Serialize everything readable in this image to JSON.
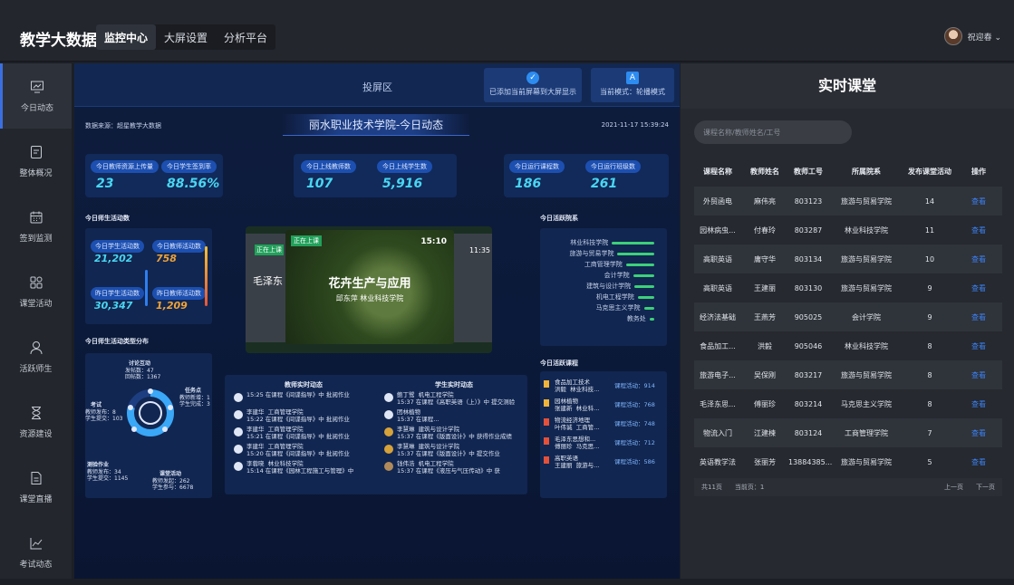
{
  "header": {
    "brand": "教学大数据",
    "tabs": [
      "监控中心",
      "大屏设置",
      "分析平台"
    ],
    "user": "祝迎春 ⌄"
  },
  "sidebar": [
    "今日动态",
    "整体概况",
    "签到监测",
    "课堂活动",
    "活跃师生",
    "资源建设",
    "课堂直播",
    "考试动态"
  ],
  "projection": {
    "title": "投屏区",
    "btn1": "已添加当前屏幕到大屏显示",
    "btn2": "当前模式：轮播模式"
  },
  "dashboard": {
    "source": "数据来源：超星教学大数据",
    "school": "丽水职业技术学院-今日动态",
    "time": "2021-11-17 15:39:24",
    "stats": [
      {
        "label": "今日教师资源上传量",
        "value": "23"
      },
      {
        "label": "今日学生签到率",
        "value": "88.56%"
      },
      {
        "label": "今日上线教师数",
        "value": "107"
      },
      {
        "label": "今日上线学生数",
        "value": "5,916"
      },
      {
        "label": "今日运行课程数",
        "value": "186"
      },
      {
        "label": "今日运行班级数",
        "value": "261"
      }
    ],
    "activity_title": "今日师生活动数",
    "activity": [
      {
        "label": "今日学生活动数",
        "value": "21,202"
      },
      {
        "label": "今日教师活动数",
        "value": "758"
      },
      {
        "label": "昨日学生活动数",
        "value": "30,347"
      },
      {
        "label": "昨日教师活动数",
        "value": "1,209"
      }
    ],
    "dist_title": "今日师生活动类型分布",
    "dist": {
      "discuss": "讨论互动",
      "discuss_v": "发帖数：47\n回帖数：1367",
      "task": "任务点",
      "task_v": "教师新增：1\n学生完成：3",
      "exam": "考试",
      "exam_v": "教师发布：8\n学生提交：103",
      "quiz": "测验作业",
      "quiz_v": "教师发布：34\n学生提交：1145",
      "class": "课堂活动",
      "class_v": "教师发起：262\n学生参与：6678"
    },
    "live": {
      "tag": "正在上课",
      "course": "花卉生产与应用",
      "teacher": "邱东萍  林业科技学院",
      "time": "15:10",
      "side_time": "11:35",
      "side_text": "毛泽东"
    },
    "dept_title": "今日活跃院系",
    "depts": [
      {
        "name": "林业科技学院",
        "v": 0.9
      },
      {
        "name": "旅游与贸易学院",
        "v": 0.78
      },
      {
        "name": "工商管理学院",
        "v": 0.6
      },
      {
        "name": "会计学院",
        "v": 0.45
      },
      {
        "name": "建筑与设计学院",
        "v": 0.42
      },
      {
        "name": "机电工程学院",
        "v": 0.35
      },
      {
        "name": "马克思主义学院",
        "v": 0.22
      },
      {
        "name": "教务处",
        "v": 0.1
      }
    ],
    "teacher_feed_title": "教师实时动态",
    "student_feed_title": "学生实时动态",
    "teacher_feed": [
      "15:25 在课程《间谍指导》中 批阅作业",
      "李建华  工商管理学院\n15:22 在课程《间谍指导》中 批阅作业",
      "李建华  工商管理学院\n15:21 在课程《间谍指导》中 批阅作业",
      "李建华  工商管理学院\n15:20 在课程《间谍指导》中 批阅作业",
      "李蓉晓  林业科技学院\n15:14 在课程《园林工程施工与管理》中"
    ],
    "student_feed": [
      "鲍丁鹭  机电工程学院\n15:37 在课程《高职英语（上）》中 提交测验",
      "团林植物\n15:37 在课程...",
      "李慧琳  建筑与设计学院\n15:37 在课程《版面设计》中 获得作业成绩",
      "李慧琳  建筑与设计学院\n15:37 在课程《版面设计》中 提交作业",
      "钱伟浩  机电工程学院\n15:37 在课程《液压与气压传动》中 获"
    ],
    "active_title": "今日活跃课程",
    "active": [
      {
        "course": "食品加工技术\n洪毅  林业科技...",
        "count": "课程活动：914"
      },
      {
        "course": "园林植物\n张建新  林业科...",
        "count": "课程活动：768"
      },
      {
        "course": "物流经济地理\n叶伟诚  工商管...",
        "count": "课程活动：748"
      },
      {
        "course": "毛泽东思想和...\n傅丽珍  马克思...",
        "count": "课程活动：712"
      },
      {
        "course": "高职英语\n王建丽  旅游与...",
        "count": "课程活动：586"
      }
    ]
  },
  "realtime": {
    "title": "实时课堂",
    "search_placeholder": "课程名称/教师姓名/工号",
    "headers": [
      "课程名称",
      "教师姓名",
      "教师工号",
      "所属院系",
      "发布课堂活动",
      "操作"
    ],
    "rows": [
      [
        "外贸函电",
        "麻伟亮",
        "803123",
        "旅游与贸易学院",
        "14",
        "查看"
      ],
      [
        "园林病虫...",
        "付春玲",
        "803287",
        "林业科技学院",
        "11",
        "查看"
      ],
      [
        "高职英语",
        "庸守华",
        "803134",
        "旅游与贸易学院",
        "10",
        "查看"
      ],
      [
        "高职英语",
        "王建丽",
        "803130",
        "旅游与贸易学院",
        "9",
        "查看"
      ],
      [
        "经济法基础",
        "王燕芳",
        "905025",
        "会计学院",
        "9",
        "查看"
      ],
      [
        "食品加工...",
        "洪毅",
        "905046",
        "林业科技学院",
        "8",
        "查看"
      ],
      [
        "旅游电子...",
        "吴保刚",
        "803217",
        "旅游与贸易学院",
        "8",
        "查看"
      ],
      [
        "毛泽东思...",
        "傅丽珍",
        "803214",
        "马克思主义学院",
        "8",
        "查看"
      ],
      [
        "物流入门",
        "江建楝",
        "803124",
        "工商管理学院",
        "7",
        "查看"
      ],
      [
        "英语教学法",
        "张丽芳",
        "13884385...",
        "旅游与贸易学院",
        "5",
        "查看"
      ]
    ],
    "pager": {
      "total": "共11页",
      "current": "当前页：1",
      "prev": "上一页",
      "next": "下一页"
    }
  }
}
